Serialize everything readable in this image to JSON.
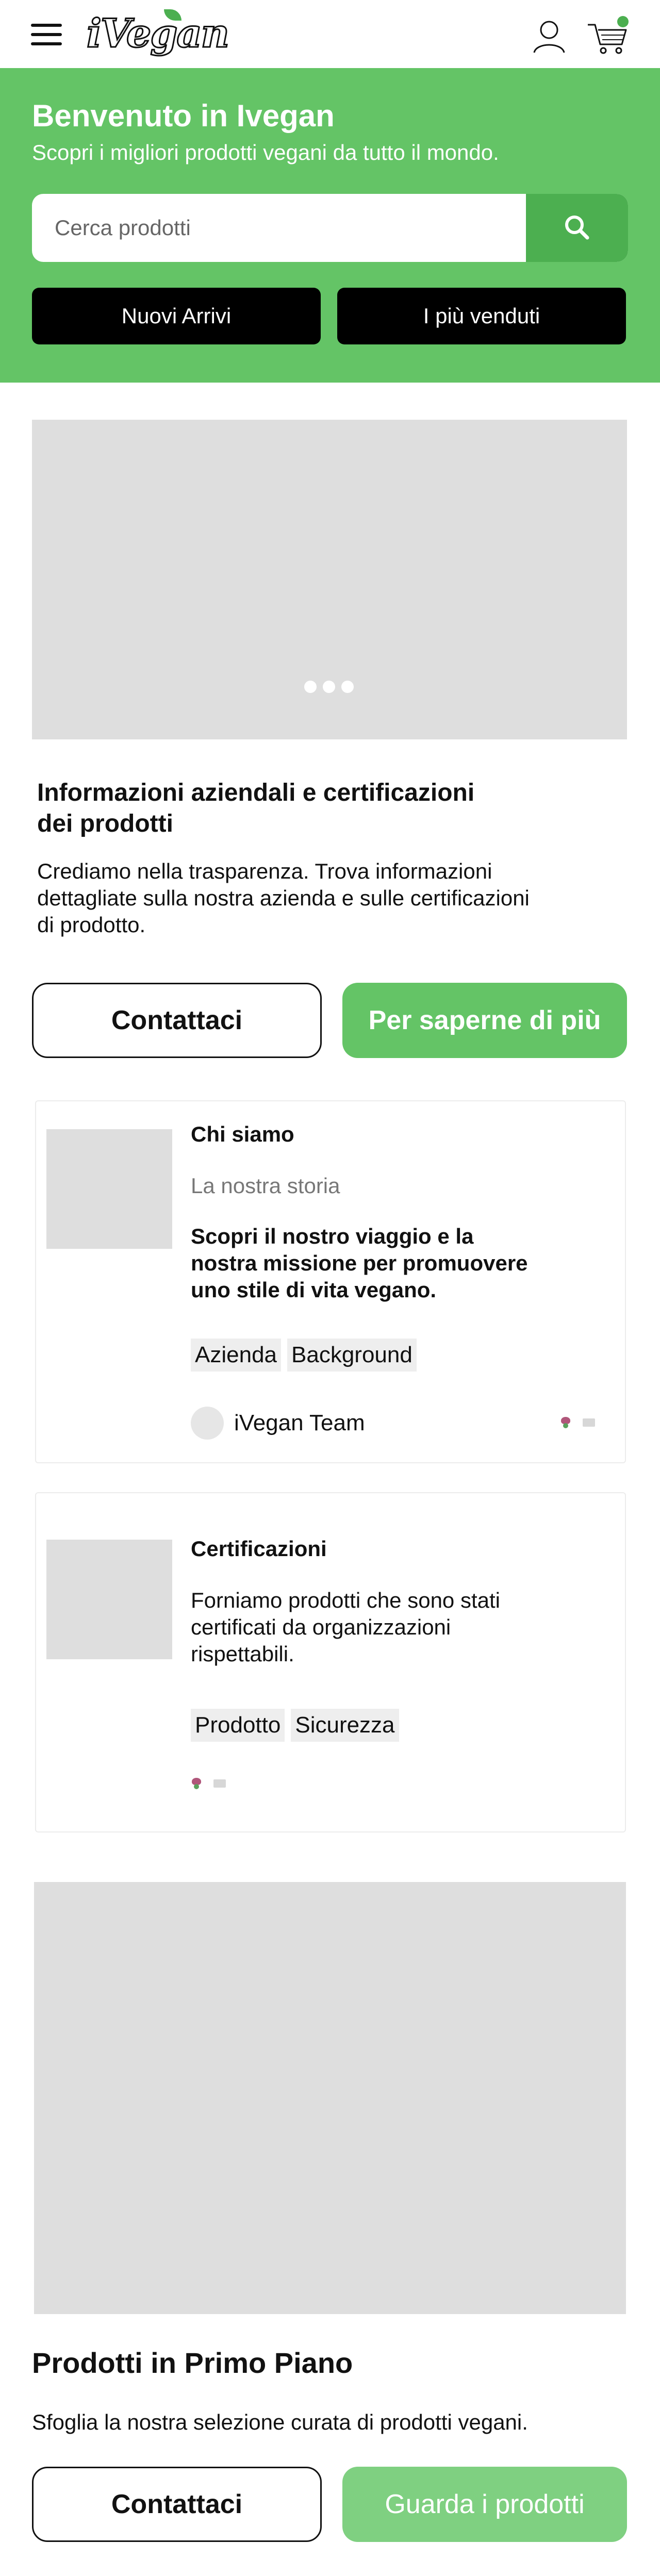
{
  "header": {
    "logo_text": "iVegan",
    "menu_icon": "hamburger-menu-icon",
    "user_icon": "user-icon",
    "cart_icon": "cart-icon",
    "cart_badge_color": "#4caf50"
  },
  "hero": {
    "title": "Benvenuto in Ivegan",
    "subtitle": "Scopri i migliori prodotti vegani da tutto il mondo.",
    "search_placeholder": "Cerca prodotti",
    "search_icon": "search-icon",
    "buttons": [
      "Nuovi Arrivi",
      "I più venduti"
    ],
    "background_color": "#64c466"
  },
  "carousel": {
    "dots_count": 3
  },
  "info_section": {
    "title_line1": "Informazioni aziendali e certificazioni",
    "title_line2": "dei prodotti",
    "text_line1": "Crediamo nella trasparenza. Trova informazioni",
    "text_line2": "dettagliate sulla nostra azienda e sulle certificazioni",
    "text_line3": "di prodotto.",
    "contact_button": "Contattaci",
    "more_button": "Per saperne di più"
  },
  "cards": [
    {
      "title": "Chi siamo",
      "subtitle": "La nostra storia",
      "body_line1": "Scopri il nostro viaggio e la",
      "body_line2": "nostra missione per promuovere",
      "body_line3": "uno stile di vita vegano.",
      "tags": [
        "Azienda",
        "Background"
      ],
      "author": "iVegan Team"
    },
    {
      "title": "Certificazioni",
      "body_line1": "Forniamo prodotti che sono stati",
      "body_line2": "certificati da organizzazioni",
      "body_line3": "rispettabili.",
      "tags": [
        "Prodotto",
        "Sicurezza"
      ]
    }
  ],
  "featured_section": {
    "title": "Prodotti in Primo Piano",
    "text": "Sfoglia la nostra selezione curata di prodotti vegani.",
    "contact_button": "Contattaci",
    "products_button": "Guarda i prodotti"
  }
}
